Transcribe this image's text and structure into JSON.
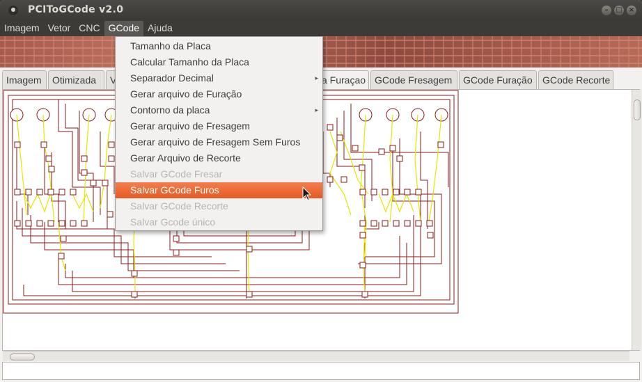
{
  "window": {
    "title": "PCIToGCode  v2.0"
  },
  "menubar": {
    "items": [
      "Imagem",
      "Vetor",
      "CNC",
      "GCode",
      "Ajuda"
    ],
    "active": "GCode"
  },
  "tabs": [
    {
      "label": "Imagem"
    },
    {
      "label": "Otimizada"
    },
    {
      "label": "V"
    },
    {
      "label": "a Furaçao"
    },
    {
      "label": "GCode Fresagem"
    },
    {
      "label": "GCode Furação"
    },
    {
      "label": "GCode Recorte"
    }
  ],
  "gcode_menu": {
    "items": [
      {
        "label": "Tamanho da Placa",
        "enabled": true,
        "submenu": false
      },
      {
        "label": "Calcular Tamanho da Placa",
        "enabled": true,
        "submenu": false
      },
      {
        "label": "Separador Decimal",
        "enabled": true,
        "submenu": true
      },
      {
        "label": "Gerar arquivo de Furação",
        "enabled": true,
        "submenu": false
      },
      {
        "label": "Contorno da placa",
        "enabled": true,
        "submenu": true
      },
      {
        "label": "Gerar arquivo de Fresagem",
        "enabled": true,
        "submenu": false
      },
      {
        "label": "Gerar arquivo de Fresagem Sem Furos",
        "enabled": true,
        "submenu": false
      },
      {
        "label": "Gerar Arquivo de Recorte",
        "enabled": true,
        "submenu": false
      },
      {
        "label": "Salvar GCode Fresar",
        "enabled": false,
        "submenu": false
      },
      {
        "label": "Salvar GCode Furos",
        "enabled": true,
        "submenu": false,
        "highlighted": true
      },
      {
        "label": "Salvar GCode Recorte",
        "enabled": false,
        "submenu": false
      },
      {
        "label": "Salvar Gcode único",
        "enabled": false,
        "submenu": false
      }
    ]
  },
  "colors": {
    "trace": "#8b1a1a",
    "route": "#e6e600",
    "highlight": "#e9662d",
    "titlebar": "#3c3b37"
  }
}
